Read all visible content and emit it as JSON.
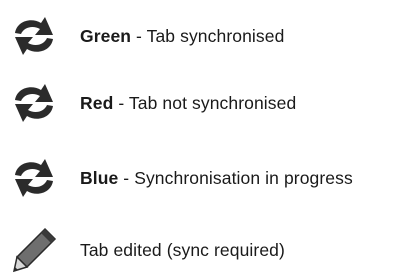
{
  "legend": {
    "items": [
      {
        "icon": "sync-arrows-icon",
        "term": "Green",
        "separator": " - ",
        "description": "Tab synchronised"
      },
      {
        "icon": "sync-arrows-icon",
        "term": "Red",
        "separator": " - ",
        "description": "Tab not synchronised"
      },
      {
        "icon": "sync-arrows-icon",
        "term": "Blue",
        "separator": " - ",
        "description": "Synchronisation in progress"
      },
      {
        "icon": "pencil-icon",
        "description": "Tab edited (sync required)"
      }
    ]
  },
  "colors": {
    "icon": "#2b2b2b",
    "text": "#1a1a1a"
  }
}
